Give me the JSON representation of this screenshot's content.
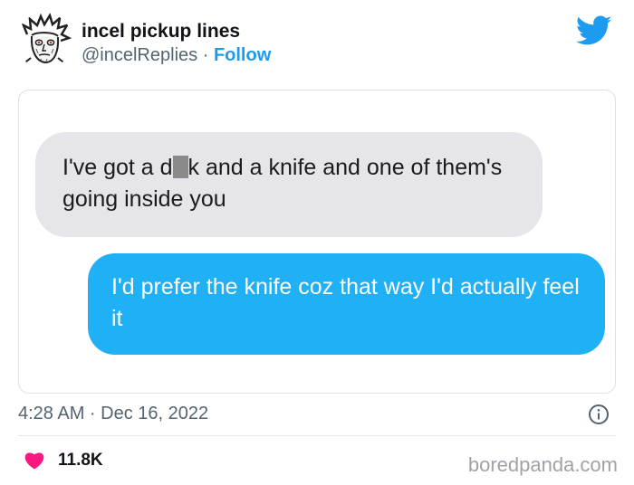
{
  "tweet": {
    "author_name": "incel pickup lines",
    "handle": "@incelReplies",
    "separator": "·",
    "follow_label": "Follow",
    "timestamp": "4:28 AM · Dec 16, 2022",
    "likes": "11.8K"
  },
  "screenshot": {
    "received_before_redaction": "I've got a d",
    "received_after_redaction": "k and a knife and one of them's going inside you",
    "sent_message": "I'd prefer the knife coz that way I'd actually feel it"
  },
  "icons": {
    "avatar": "sketch-face-avatar",
    "logo": "twitter-bird-icon",
    "info": "info-circle-icon",
    "like": "heart-icon"
  },
  "colors": {
    "follow": "#1d9bf0",
    "sent_bubble": "#1fb0f5",
    "received_bubble": "#e5e5ea",
    "heart": "#f91880",
    "muted_text": "#536471"
  },
  "watermark": "boredpanda.com"
}
